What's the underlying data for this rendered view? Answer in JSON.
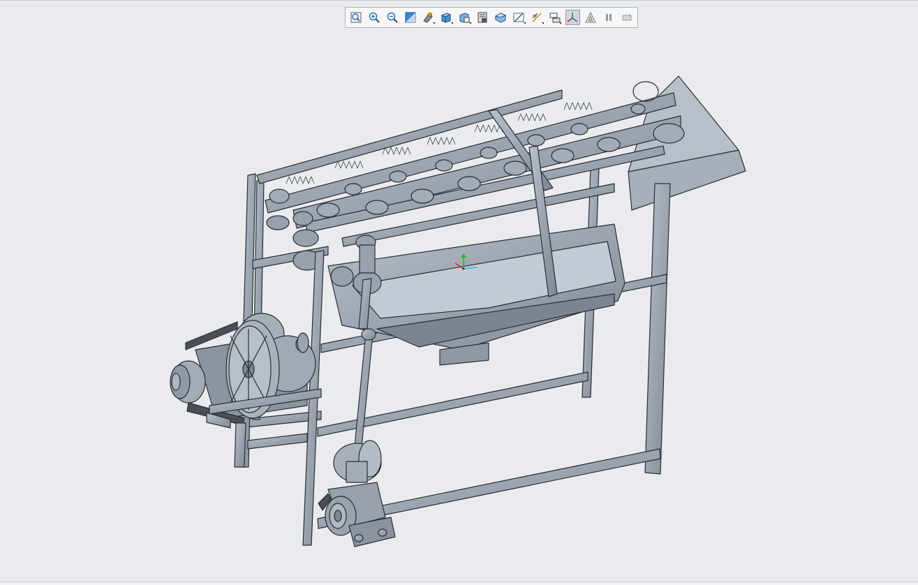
{
  "window": {
    "background": "#e9ebef"
  },
  "toolbar": {
    "buttons": [
      {
        "name": "refit-icon",
        "active": false
      },
      {
        "name": "zoom-in-icon",
        "active": false
      },
      {
        "name": "zoom-out-icon",
        "active": false
      },
      {
        "name": "repaint-icon",
        "active": false
      },
      {
        "name": "spin-center-icon",
        "active": false
      },
      {
        "name": "display-style-icon",
        "active": false
      },
      {
        "name": "saved-views-icon",
        "active": false
      },
      {
        "name": "view-manager-icon",
        "active": false
      },
      {
        "name": "perspective-view-icon",
        "active": false
      },
      {
        "name": "sketch-view-icon",
        "active": false
      },
      {
        "name": "datum-display-icon",
        "active": false
      },
      {
        "name": "annotation-display-icon",
        "active": false
      },
      {
        "name": "csys-display-icon",
        "active": true
      },
      {
        "name": "point-display-icon",
        "active": false
      },
      {
        "name": "pause-icon",
        "active": false
      },
      {
        "name": "regenerate-icon",
        "active": false
      }
    ]
  },
  "model": {
    "steel_color": "#9aa3af",
    "dark_edge": "#2a2d33",
    "axis_colors": {
      "x": "#ff2020",
      "y": "#18c018",
      "z": "#20c8d8"
    }
  }
}
